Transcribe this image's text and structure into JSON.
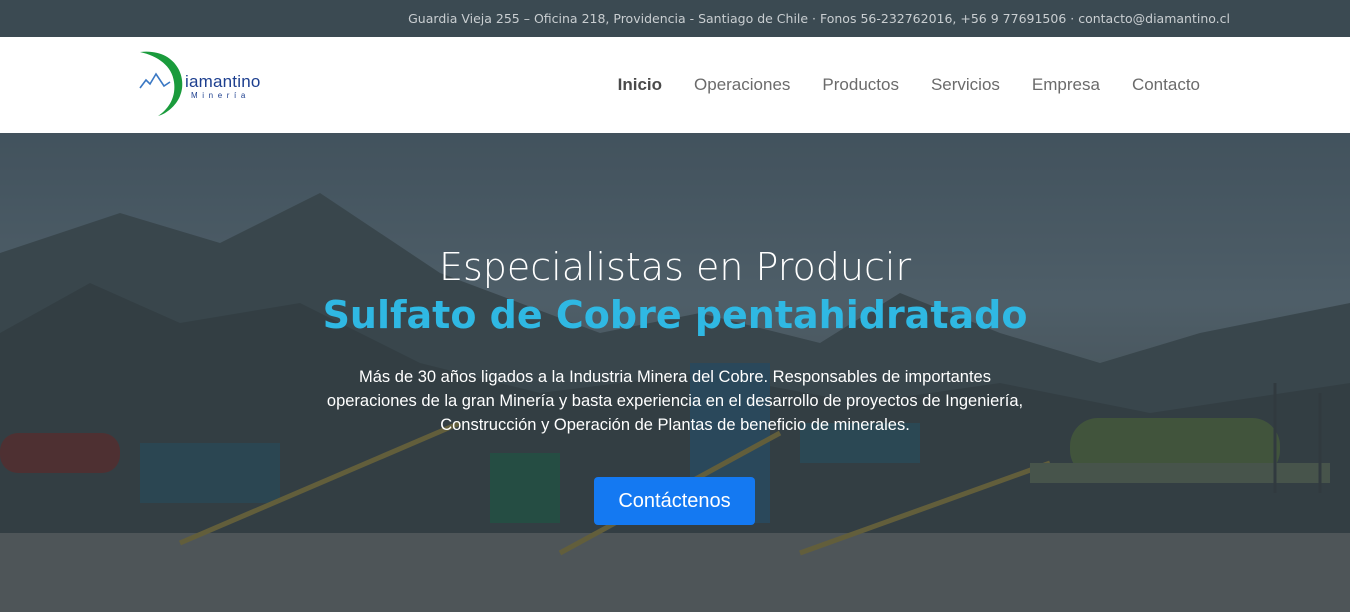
{
  "topbar": {
    "contact_line": "Guardia Vieja 255 – Oficina 218, Providencia - Santiago de Chile · Fonos 56-232762016, +56 9 77691506 · contacto@diamantino.cl"
  },
  "brand": {
    "name": "iamantino",
    "subtitle": "Minería",
    "colors": {
      "arc": "#1a9b3c",
      "text": "#1d3f8f",
      "mountain": "#3a78c4"
    }
  },
  "nav": {
    "items": [
      {
        "label": "Inicio",
        "active": true
      },
      {
        "label": "Operaciones"
      },
      {
        "label": "Productos"
      },
      {
        "label": "Servicios"
      },
      {
        "label": "Empresa"
      },
      {
        "label": "Contacto"
      }
    ]
  },
  "hero": {
    "title_line1": "Especialistas en Producir",
    "title_line2": "Sulfato de Cobre pentahidratado",
    "description": "Más de 30 años ligados a la Industria Minera del Cobre. Responsables de importantes operaciones de la gran Minería y basta experiencia en el desarrollo de proyectos de Ingeniería, Construcción y Operación de Plantas de beneficio de minerales.",
    "cta_label": "Contáctenos",
    "accent_color": "#2fb8e3",
    "button_color": "#1479f2"
  }
}
